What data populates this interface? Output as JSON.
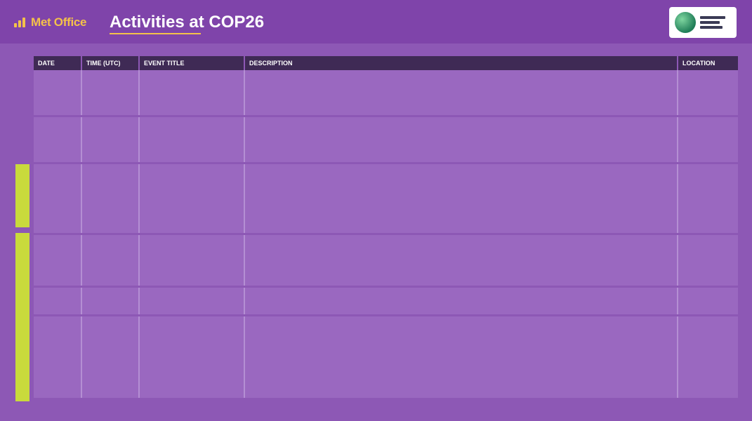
{
  "header": {
    "logo_text": "Met Office",
    "title": "Activities at COP26"
  },
  "side_tags": [
    "",
    ""
  ],
  "table": {
    "columns": [
      "DATE",
      "TIME (UTC)",
      "EVENT TITLE",
      "DESCRIPTION",
      "LOCATION"
    ]
  },
  "colors": {
    "background": "#8d58b5",
    "header_band": "#7f44aa",
    "accent": "#f4c14a",
    "tag": "#c9da3c",
    "table_header": "#3f2a55"
  }
}
